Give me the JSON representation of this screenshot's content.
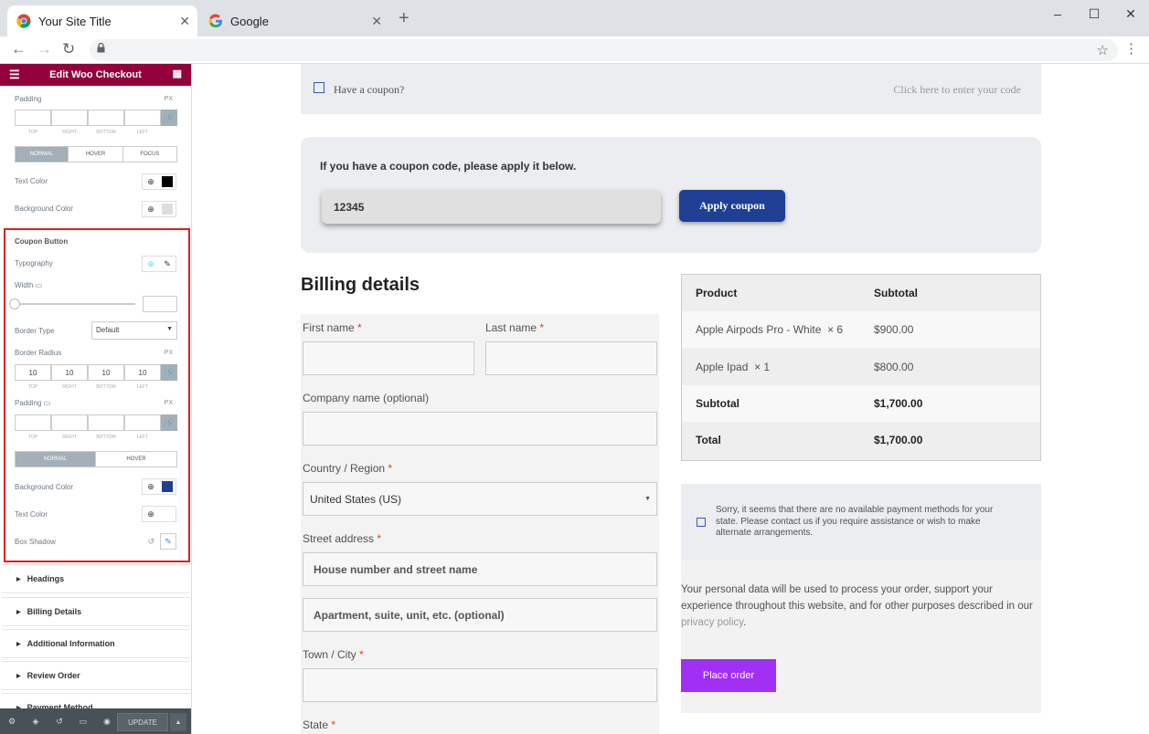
{
  "browser": {
    "tabs": [
      {
        "title": "Your Site Title",
        "favicon": "chrome-icon"
      },
      {
        "title": "Google",
        "favicon": "google-icon"
      }
    ]
  },
  "panel": {
    "title": "Edit Woo Checkout",
    "padding_label": "Padding",
    "unit_px": "PX",
    "dim_labels": [
      "TOP",
      "RIGHT",
      "BOTTOM",
      "LEFT"
    ],
    "state_tabs_3": [
      "NORMAL",
      "HOVER",
      "FOCUS"
    ],
    "text_color_label": "Text Color",
    "background_color_label": "Background Color",
    "coupon_button": {
      "heading": "Coupon Button",
      "typography_label": "Typography",
      "width_label": "Width",
      "border_type_label": "Border Type",
      "border_type_value": "Default",
      "border_radius_label": "Border Radius",
      "border_radius_values": [
        "10",
        "10",
        "10",
        "10"
      ],
      "padding_label": "Padding",
      "state_tabs_2": [
        "NORMAL",
        "HOVER"
      ],
      "background_color_label": "Background Color",
      "text_color_label": "Text Color",
      "box_shadow_label": "Box Shadow",
      "bg_swatch": "#1e3f94"
    },
    "sections": [
      "Headings",
      "Billing Details",
      "Additional Information",
      "Review Order",
      "Payment Method"
    ],
    "footer": {
      "update_label": "UPDATE"
    }
  },
  "page": {
    "notice": {
      "text": "Have a coupon?",
      "link": "Click here to enter your code"
    },
    "coupon": {
      "prompt": "If you have a coupon code, please apply it below.",
      "code": "12345",
      "button": "Apply coupon",
      "button_color": "#1e3f94"
    },
    "billing": {
      "title": "Billing details",
      "first_name": "First name",
      "last_name": "Last name",
      "company": "Company name (optional)",
      "country_label": "Country / Region",
      "country_value": "United States (US)",
      "street_label": "Street address",
      "street_placeholder": "House number and street name",
      "street2_placeholder": "Apartment, suite, unit, etc. (optional)",
      "city_label": "Town / City",
      "state_label": "State",
      "required_mark": "*"
    },
    "order": {
      "col_product": "Product",
      "col_subtotal": "Subtotal",
      "rows": [
        {
          "product": "Apple Airpods Pro - White",
          "qty": "× 6",
          "subtotal": "$900.00"
        },
        {
          "product": "Apple Ipad",
          "qty": "× 1",
          "subtotal": "$800.00"
        }
      ],
      "subtotal_label": "Subtotal",
      "subtotal_value": "$1,700.00",
      "total_label": "Total",
      "total_value": "$1,700.00"
    },
    "payment": {
      "notice": "Sorry, it seems that there are no available payment methods for your state. Please contact us if you require assistance or wish to make alternate arrangements.",
      "privacy_text": "Your personal data will be used to process your order, support your experience throughout this website, and for other purposes described in our",
      "privacy_link": "privacy policy",
      "place_order": "Place order",
      "place_order_color": "#a12ff4"
    }
  }
}
